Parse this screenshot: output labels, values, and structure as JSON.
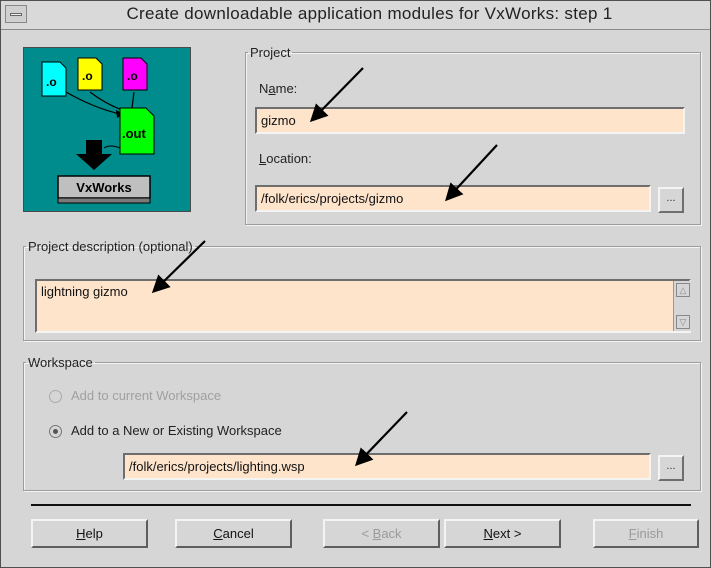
{
  "window": {
    "title": "Create downloadable application modules for VxWorks: step 1"
  },
  "graphic": {
    "file_labels": [
      ".o",
      ".o",
      ".o"
    ],
    "output_label": ".out",
    "target_label": "VxWorks",
    "file_colors": [
      "#00ffff",
      "#ffff00",
      "#ff00ff"
    ],
    "output_color": "#00ff00"
  },
  "project": {
    "legend": "Project",
    "name_label": {
      "before": "N",
      "accel": "a",
      "after": "me:"
    },
    "name_value": "gizmo",
    "location_label": {
      "before": "",
      "accel": "L",
      "after": "ocation:"
    },
    "location_value": "/folk/erics/projects/gizmo",
    "browse_label": "..."
  },
  "description": {
    "legend": "Project description (optional)",
    "value": "lightning gizmo"
  },
  "workspace": {
    "legend": "Workspace",
    "option_current": "Add to current Workspace",
    "option_new": "Add to a New or Existing Workspace",
    "path_value": "/folk/erics/projects/lighting.wsp",
    "browse_label": "..."
  },
  "buttons": {
    "help": {
      "before": "",
      "accel": "H",
      "after": "elp"
    },
    "cancel": {
      "before": "",
      "accel": "C",
      "after": "ancel"
    },
    "back": {
      "before": "< ",
      "accel": "B",
      "after": "ack"
    },
    "next": {
      "before": "",
      "accel": "N",
      "after": "ext >"
    },
    "finish": {
      "before": "",
      "accel": "F",
      "after": "inish"
    }
  },
  "colors": {
    "window_bg": "#d6d6d6",
    "field_bg": "#ffe4cc",
    "graphic_bg": "#008c8c"
  }
}
